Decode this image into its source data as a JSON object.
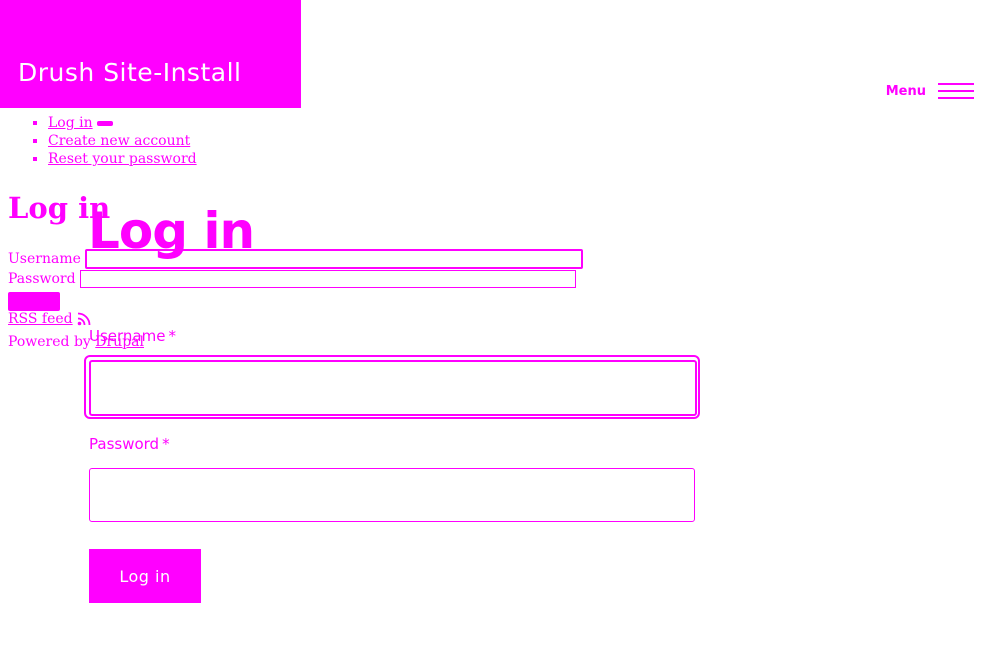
{
  "site": {
    "name": "Drush Site-Install"
  },
  "menu": {
    "label": "Menu",
    "icon": "hamburger-icon"
  },
  "tabs": [
    {
      "label": "Log in",
      "active": true
    },
    {
      "label": "Create new account"
    },
    {
      "label": "Reset your password"
    }
  ],
  "page": {
    "title": "Log in"
  },
  "form": {
    "username_label": "Username",
    "password_label": "Password",
    "required_marker": "*",
    "username_value": "",
    "password_value": "",
    "submit_label": "Log in"
  },
  "footer": {
    "rss_label": "RSS feed",
    "powered_prefix": "Powered by",
    "powered_link": "Drupal"
  },
  "colors": {
    "accent": "#ff00ff",
    "background": "#ffffff",
    "text_on_accent": "#ffffff"
  }
}
